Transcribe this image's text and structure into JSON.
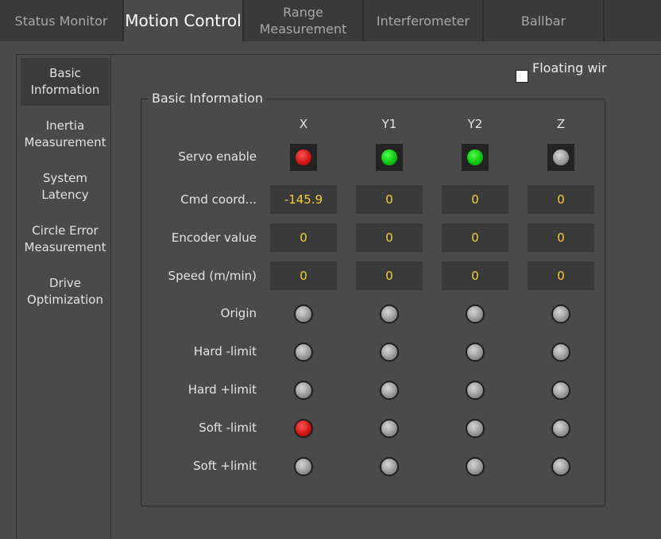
{
  "tabs": [
    {
      "label": "Status Monitor",
      "active": false
    },
    {
      "label": "Motion Control",
      "active": true
    },
    {
      "label": "Range\nMeasurement",
      "active": false
    },
    {
      "label": "Interferometer",
      "active": false
    },
    {
      "label": "Ballbar",
      "active": false
    }
  ],
  "sidebar": {
    "items": [
      {
        "label": "Basic\nInformation",
        "active": true
      },
      {
        "label": "Inertia\nMeasurement",
        "active": false
      },
      {
        "label": "System\nLatency",
        "active": false
      },
      {
        "label": "Circle Error\nMeasurement",
        "active": false
      },
      {
        "label": "Drive\nOptimization",
        "active": false
      }
    ]
  },
  "floating": {
    "label": "Floating wir",
    "checked": false
  },
  "group": {
    "title": "Basic Information",
    "axes": [
      "X",
      "Y1",
      "Y2",
      "Z"
    ],
    "servo": {
      "label": "Servo enable",
      "states": [
        "red",
        "green",
        "green",
        "gray"
      ]
    },
    "value_rows": [
      {
        "label": "Cmd coord...",
        "values": [
          "-145.9",
          "0",
          "0",
          "0"
        ]
      },
      {
        "label": "Encoder value",
        "values": [
          "0",
          "0",
          "0",
          "0"
        ]
      },
      {
        "label": "Speed (m/min)",
        "values": [
          "0",
          "0",
          "0",
          "0"
        ]
      }
    ],
    "indicator_rows": [
      {
        "label": "Origin",
        "states": [
          "gray",
          "gray",
          "gray",
          "gray"
        ]
      },
      {
        "label": "Hard -limit",
        "states": [
          "gray",
          "gray",
          "gray",
          "gray"
        ]
      },
      {
        "label": "Hard +limit",
        "states": [
          "gray",
          "gray",
          "gray",
          "gray"
        ]
      },
      {
        "label": "Soft -limit",
        "states": [
          "red",
          "gray",
          "gray",
          "gray"
        ]
      },
      {
        "label": "Soft +limit",
        "states": [
          "gray",
          "gray",
          "gray",
          "gray"
        ]
      }
    ]
  },
  "colors": {
    "red": "#d01818",
    "green": "#12c412",
    "gray": "#9a9a9a",
    "value_text": "#f2cf3a"
  }
}
